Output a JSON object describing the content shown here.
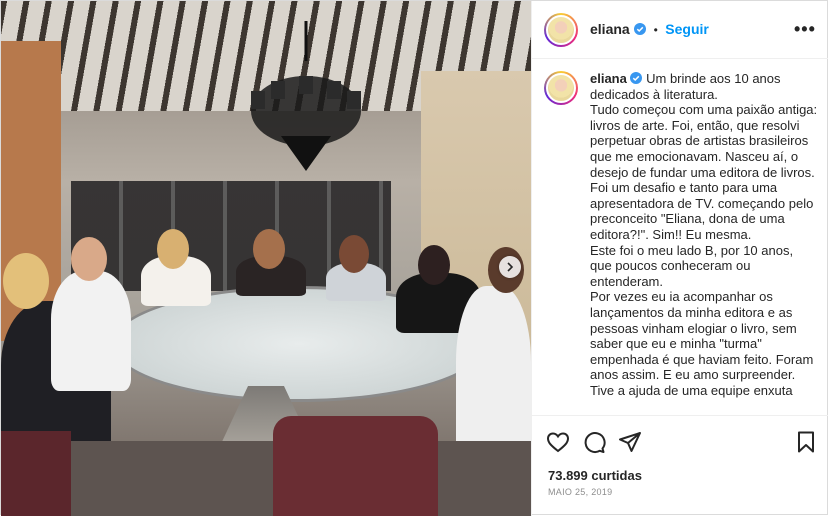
{
  "header": {
    "username": "eliana",
    "follow_label": "Seguir",
    "separator": "•",
    "more_label": "•••"
  },
  "caption": {
    "username": "eliana",
    "paragraphs": [
      "Um brinde aos 10 anos dedicados à literatura.",
      "Tudo começou com uma paixão antiga: livros de arte. Foi, então, que resolvi perpetuar obras de artistas brasileiros que me emocionavam. Nasceu aí, o desejo de fundar uma editora de livros.",
      "Foi um desafio e tanto para uma apresentadora de TV. começando pelo preconceito \"Eliana, dona de uma editora?!\". Sim!! Eu mesma.",
      "Este foi o meu lado B, por 10 anos, que poucos conheceram ou entenderam.",
      "Por vezes eu ia acompanhar os lançamentos da minha editora e as pessoas vinham elogiar o livro, sem saber que eu e minha \"turma\" empenhada é que haviam feito. Foram anos assim. E eu amo surpreender.",
      "Tive a ajuda de uma equipe enxuta"
    ]
  },
  "stats": {
    "likes": "73.899 curtidas",
    "date": "MAIO 25, 2019"
  },
  "icons": {
    "like": "heart-icon",
    "comment": "comment-icon",
    "share": "share-icon",
    "save": "bookmark-icon",
    "verified": "verified-badge-icon",
    "next": "chevron-right-icon"
  },
  "colors": {
    "link": "#0095f6",
    "verified": "#3897f0",
    "muted": "#8e8e8e",
    "text": "#262626"
  }
}
